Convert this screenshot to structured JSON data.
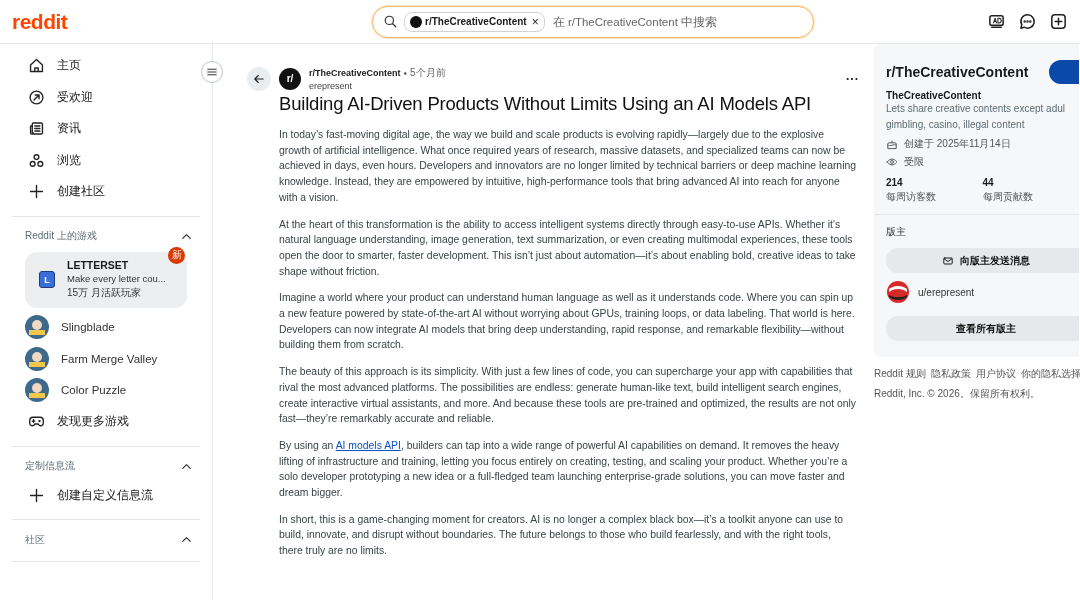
{
  "header": {
    "logo": "reddit",
    "search": {
      "chip": "r/TheCreativeContent",
      "chip_close": "×",
      "placeholder": "在 r/TheCreativeContent 中搜索"
    }
  },
  "sidebar": {
    "nav": [
      {
        "label": "主页"
      },
      {
        "label": "受欢迎"
      },
      {
        "label": "资讯"
      },
      {
        "label": "浏览"
      },
      {
        "label": "创建社区"
      }
    ],
    "sections": [
      {
        "title": "Reddit 上的游戏",
        "expanded": true,
        "items": [
          {
            "kind": "featured",
            "title": "LETTERSET",
            "subtitle": "Make every letter cou...",
            "meta": "15万 月活跃玩家",
            "badge": "新",
            "letter": "L"
          },
          {
            "kind": "game",
            "label": "Slingblade"
          },
          {
            "kind": "game",
            "label": "Farm Merge Valley"
          },
          {
            "kind": "game",
            "label": "Color Puzzle"
          },
          {
            "kind": "discover",
            "label": "发现更多游戏"
          }
        ]
      },
      {
        "title": "定制信息流",
        "expanded": true,
        "items": [
          {
            "kind": "create",
            "label": "创建自定义信息流"
          }
        ]
      },
      {
        "title": "社区",
        "expanded": true
      }
    ]
  },
  "post": {
    "community": "r/TheCreativeContent",
    "avatar": "r/",
    "separator": "•",
    "time": "5个月前",
    "author": "erepresent",
    "more": "...",
    "title": "Building AI-Driven Products Without Limits Using an AI Models API",
    "paragraphs": [
      "In today’s fast-moving digital age, the way we build and scale products is evolving rapidly—largely due to the explosive growth of artificial intelligence. What once required years of research, massive datasets, and specialized teams can now be achieved in days, even hours. Developers and innovators are no longer limited by technical barriers or deep machine learning knowledge. Instead, they are empowered by intuitive, high-performance tools that bring advanced AI into reach for anyone with a vision.",
      "At the heart of this transformation is the ability to access intelligent systems directly through easy-to-use APIs. Whether it’s natural language understanding, image generation, text summarization, or even creating multimodal experiences, these tools open the door to smarter, faster development. This isn’t just about automation—it’s about enabling bold, creative ideas to take shape without friction.",
      "Imagine a world where your product can understand human language as well as it understands code. Where you can spin up a new feature powered by state-of-the-art AI without worrying about GPUs, training loops, or data labeling. That world is here. Developers can now integrate AI models that bring deep understanding, rapid response, and remarkable flexibility—without building them from scratch.",
      "The beauty of this approach is its simplicity. With just a few lines of code, you can supercharge your app with capabilities that rival the most advanced platforms. The possibilities are endless: generate human-like text, build intelligent search engines, create interactive virtual assistants, and more. And because these tools are pre-trained and optimized, the results are not only fast—they’re remarkably accurate and reliable.",
      {
        "before": "By using an ",
        "link": "AI models API",
        "after": ", builders can tap into a wide range of powerful AI capabilities on demand. It removes the heavy lifting of infrastructure and training, letting you focus entirely on creating, testing, and scaling your product. Whether you’re a solo developer prototyping a new idea or a full-fledged team launching enterprise-grade solutions, you can move faster and dream bigger."
      },
      "In short, this is a game-changing moment for creators. AI is no longer a complex black box—it’s a toolkit anyone can use to build, innovate, and disrupt without boundaries. The future belongs to those who build fearlessly, and with the right tools, there truly are no limits."
    ]
  },
  "community_panel": {
    "name": "r/TheCreativeContent",
    "title": "TheCreativeContent",
    "description": "Lets share creative contents except adul gimbling, casino, illegal content",
    "created": "创建于 2025年11月14日",
    "access": "受限",
    "stats": [
      {
        "value": "214",
        "label": "每周访客数"
      },
      {
        "value": "44",
        "label": "每周贡献数"
      }
    ],
    "moderators_heading": "版主",
    "message_button": "向版主发送消息",
    "moderators": [
      {
        "name": "u/erepresent"
      }
    ],
    "view_all_button": "查看所有版主"
  },
  "footer": {
    "links": [
      "Reddit 规则",
      "隐私政策",
      "用户协议",
      "你的隐私选择"
    ],
    "copyright": "Reddit, Inc. © 2026。保留所有权利。"
  }
}
